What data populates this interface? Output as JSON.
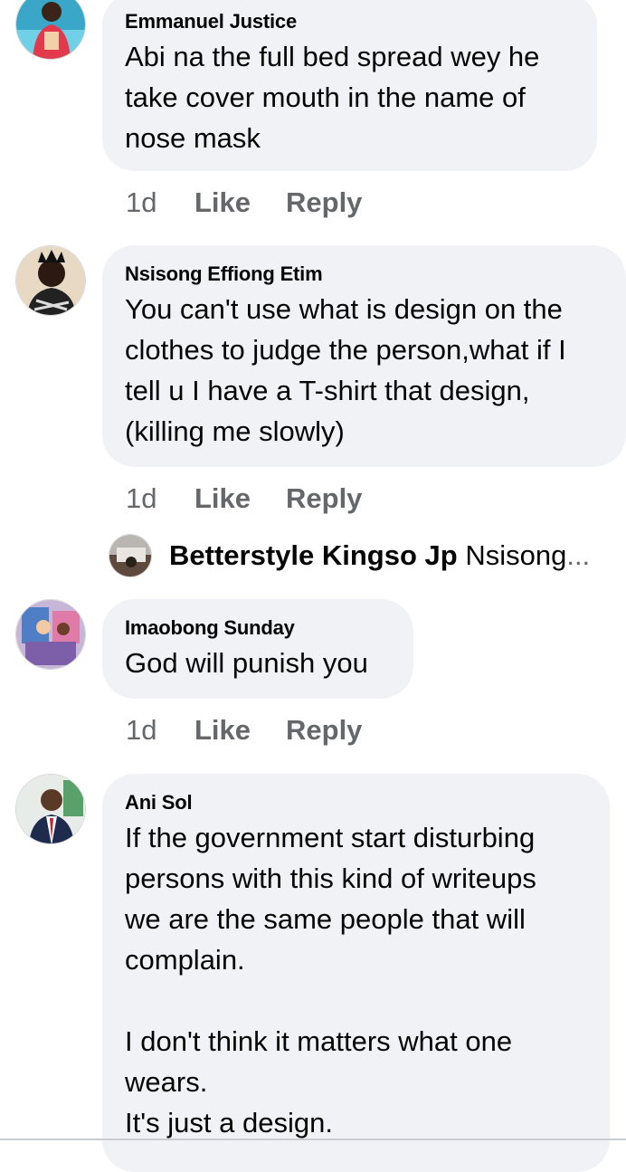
{
  "comments": [
    {
      "author": "Emmanuel Justice",
      "text": "Abi na the full bed spread wey he\ntake cover mouth in the name of\nnose mask",
      "time": "1d",
      "like": "Like",
      "reply": "Reply"
    },
    {
      "author": "Nsisong Effiong Etim",
      "text": "You can't use what is design on the\nclothes to judge the person,what if I\ntell u I have a T-shirt that design,\n(killing me slowly)",
      "time": "1d",
      "like": "Like",
      "reply": "Reply"
    },
    {
      "author": "Imaobong Sunday",
      "text": "God will punish you",
      "time": "1d",
      "like": "Like",
      "reply": "Reply"
    },
    {
      "author": "Ani Sol",
      "text": "If the government start disturbing\npersons with this kind of writeups\nwe are the same people that will\ncomplain.\n\nI don't think it matters what one\nwears.\nIt's just a design."
    }
  ],
  "reply_preview": {
    "author": "Betterstyle Kingso Jp",
    "snippet": "Nsisong",
    "ellipsis": "..."
  },
  "colors": {
    "bubble": "#f0f2f5",
    "secondary_text": "#65676b",
    "primary_text": "#050505"
  }
}
